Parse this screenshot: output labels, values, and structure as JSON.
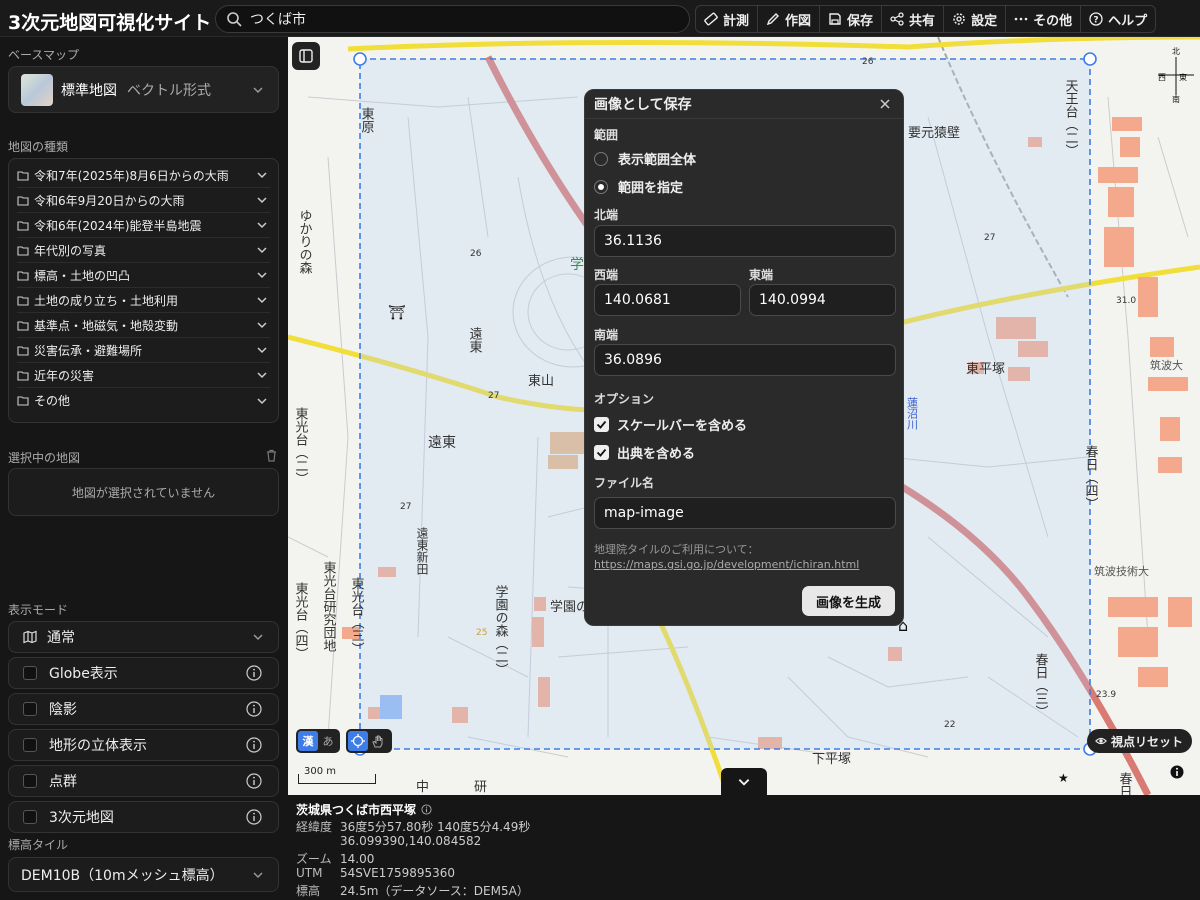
{
  "app": {
    "title": "3次元地図可視化サイト"
  },
  "search": {
    "value": "つくば市",
    "placeholder": ""
  },
  "toolbar": {
    "items": [
      {
        "label": "計測",
        "icon": "ruler-icon"
      },
      {
        "label": "作図",
        "icon": "pencil-icon"
      },
      {
        "label": "保存",
        "icon": "save-icon"
      },
      {
        "label": "共有",
        "icon": "share-icon"
      },
      {
        "label": "設定",
        "icon": "gear-icon"
      },
      {
        "label": "その他",
        "icon": "more-icon"
      },
      {
        "label": "ヘルプ",
        "icon": "help-icon"
      }
    ]
  },
  "sidebar": {
    "basemap_label": "ベースマップ",
    "basemap_name": "標準地図",
    "basemap_sub": "ベクトル形式",
    "maptypes_label": "地図の種類",
    "maptypes": [
      "令和7年(2025年)8月6日からの大雨",
      "令和6年9月20日からの大雨",
      "令和6年(2024年)能登半島地震",
      "年代別の写真",
      "標高・土地の凹凸",
      "土地の成り立ち・土地利用",
      "基準点・地磁気・地殻変動",
      "災害伝承・避難場所",
      "近年の災害",
      "その他"
    ],
    "selected_label": "選択中の地図",
    "selected_empty": "地図が選択されていません",
    "displaymode_label": "表示モード",
    "displaymode_value": "通常",
    "toggles": [
      "Globe表示",
      "陰影",
      "地形の立体表示",
      "点群",
      "3次元地図"
    ],
    "elev_label": "標高タイル",
    "elev_value": "DEM10B（10mメッシュ標高）"
  },
  "map": {
    "labels": {
      "higashihara": "東原",
      "yukari": "ゆかりの森",
      "touto1": "遠東",
      "higashiyama": "東山",
      "touto2": "遠東",
      "toutoshinden": "遠東新田",
      "higashikoudai": "東光台（二）",
      "higashikoudai3": "東光台（三）",
      "kenkyudanchi": "東光台研究団地",
      "higashikoudai4": "東光台（四）",
      "gakuen": "学園の森（二）",
      "gakuen2": "学園の",
      "gaku": "学",
      "yogen": "要元猿壁",
      "tenno": "天王台（二）",
      "higashihiratsuka": "東平塚",
      "hasunuma": "蓮沼川",
      "kasuga4": "春日（四）",
      "kasuga3": "春日（三）",
      "kasuga": "春日",
      "tsukubadai": "筑波大",
      "tsukubagijutsu": "筑波技術大",
      "shimohiratsuka": "下平塚",
      "naka": "中",
      "ken": "研",
      "n26a": "26",
      "n26b": "26",
      "n27a": "27",
      "n27b": "27",
      "n27c": "27",
      "n22": "22",
      "n31": "31.0",
      "n239": "23.9",
      "n25": "25"
    },
    "compass": {
      "n": "北",
      "e": "東",
      "w": "西",
      "s": "南"
    },
    "scale_label": "300 m",
    "kanji_toggle": "漢",
    "kana_toggle": "あ",
    "reset_view": "視点リセット"
  },
  "dialog": {
    "title": "画像として保存",
    "range_label": "範囲",
    "radio_all": "表示範囲全体",
    "radio_custom": "範囲を指定",
    "north_label": "北端",
    "north": "36.1136",
    "west_label": "西端",
    "west": "140.0681",
    "east_label": "東端",
    "east": "140.0994",
    "south_label": "南端",
    "south": "36.0896",
    "options_label": "オプション",
    "opt_scale": "スケールバーを含める",
    "opt_credit": "出典を含める",
    "filename_label": "ファイル名",
    "filename": "map-image",
    "note": "地理院タイルのご利用について：",
    "note_link": "https://maps.gsi.go.jp/development/ichiran.html",
    "generate": "画像を生成"
  },
  "info": {
    "title": "茨城県つくば市西平塚",
    "coord_key": "経緯度",
    "coord_dms": "36度5分57.80秒 140度5分4.49秒",
    "coord_dec": "36.099390,140.084582",
    "zoom_key": "ズーム",
    "zoom": "14.00",
    "utm_key": "UTM",
    "utm": "54SVE1759895360",
    "elev_key": "標高",
    "elev": "24.5m（データソース：DEM5A）"
  }
}
